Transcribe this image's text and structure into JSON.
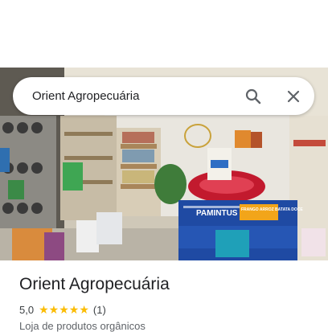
{
  "search": {
    "query": "Orient Agropecuária"
  },
  "place": {
    "name": "Orient Agropecuária",
    "rating": "5,0",
    "stars": 5,
    "review_count": "(1)",
    "category": "Loja de produtos orgânicos"
  },
  "photo": {
    "sign_text": "PAMINTUS",
    "bag_text": "FRANGO ARROZ BATATA DOCE"
  },
  "icons": {
    "search": "search-icon",
    "close": "close-icon",
    "star": "star-icon"
  },
  "colors": {
    "star": "#fbbc04",
    "text_primary": "#202124",
    "text_secondary": "#5f6368"
  }
}
